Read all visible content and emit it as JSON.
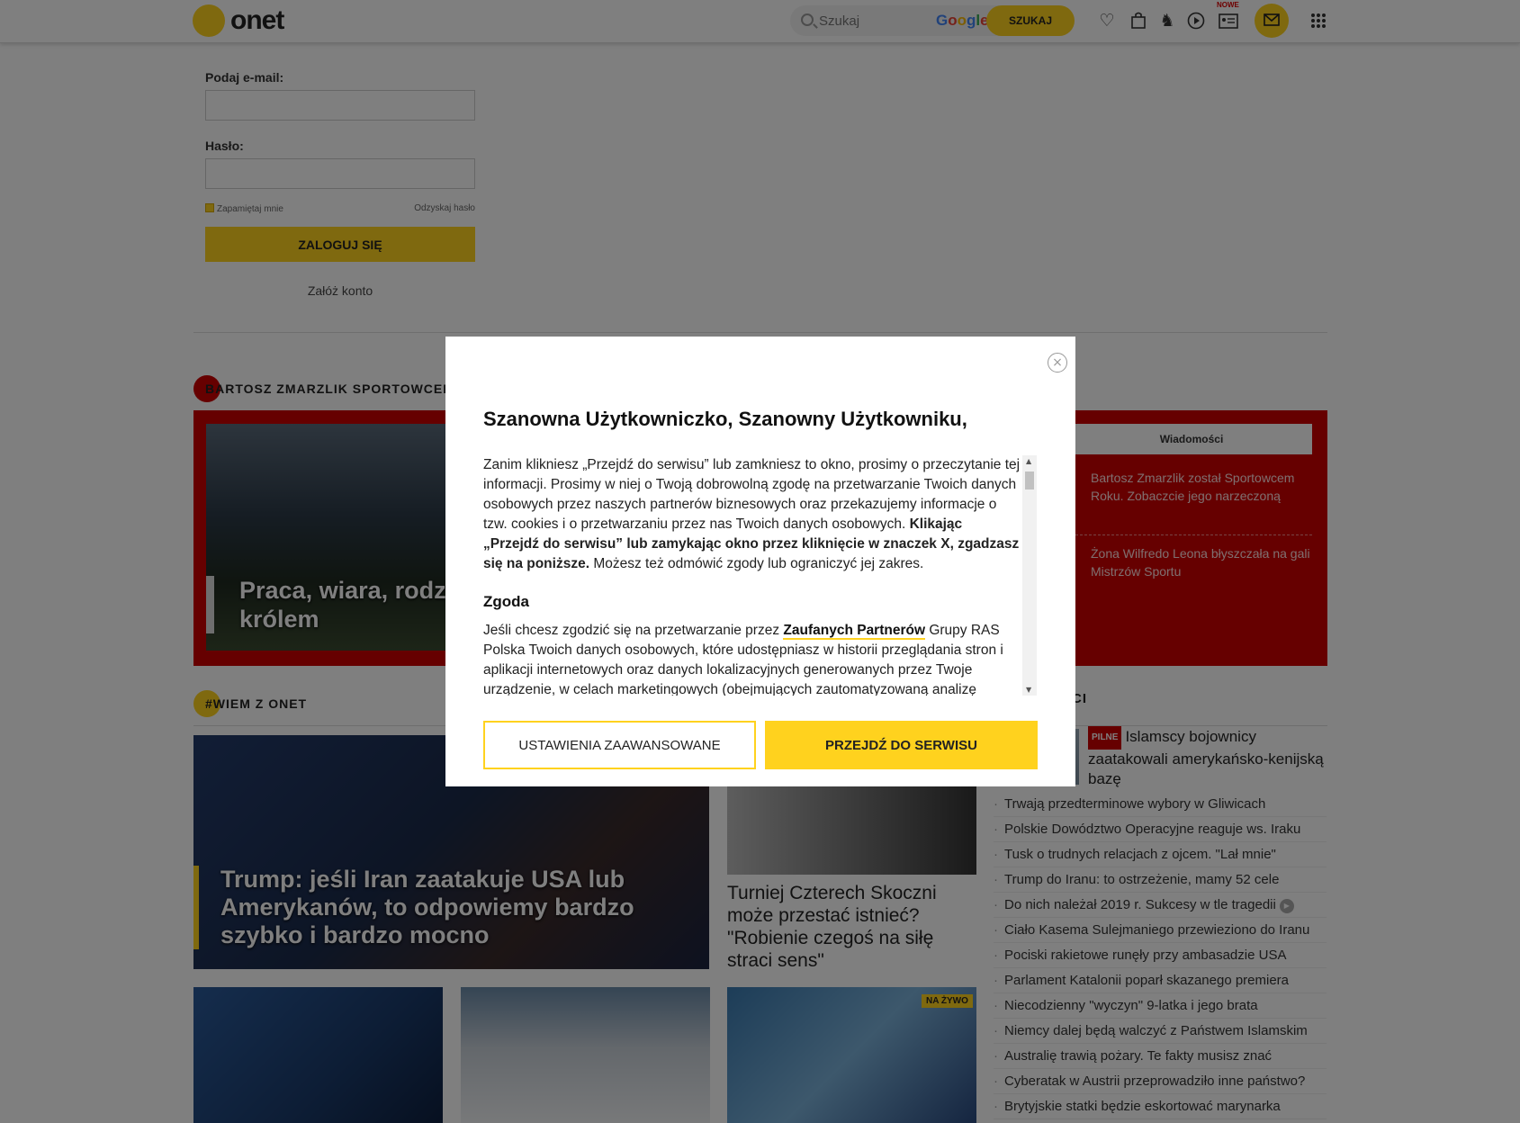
{
  "header": {
    "logo_text": "onet",
    "search_placeholder": "Szukaj",
    "google_letters": [
      "G",
      "o",
      "o",
      "g",
      "l",
      "e"
    ],
    "search_button": "SZUKAJ",
    "new_badge": "NOWE",
    "icons": [
      "heart-icon",
      "shopping-bag-icon",
      "horoscope-icon",
      "play-icon",
      "news-card-icon",
      "mail-icon",
      "apps-grid-icon"
    ]
  },
  "login": {
    "email_label": "Podaj e-mail:",
    "password_label": "Hasło:",
    "remember_label": "Zapamiętaj mnie",
    "recover_label": "Odzyskaj hasło",
    "submit_label": "ZALOGUJ SIĘ",
    "register_label": "Załóż konto"
  },
  "sport": {
    "section_title": "BARTOSZ ZMARZLIK SPORTOWCEM R",
    "headline": "Praca, wiara, rodzin który został królem",
    "tab_label": "Wiadomości",
    "side_news": [
      "Bartosz Zmarzlik został Sportowcem Roku. Zobaczcie jego narzeczoną",
      "Żona Wilfredo Leona błyszczała na gali Mistrzów Sportu"
    ]
  },
  "wiem": {
    "section_title": "#WIEM Z ONET",
    "main_headline": "Trump: jeśli Iran zaatakuje USA lub Amerykanów, to odpowiemy bardzo szybko i bardzo mocno",
    "skocznia_headline": "Turniej Czterech Skoczni może przestać istnieć? \"Robienie czegoś na siłę straci sens\"",
    "live_badge": "NA ŻYWO"
  },
  "news": {
    "section_title": "ŚCI",
    "pilne_badge": "PILNE",
    "pilne_headline": "Islamscy bojownicy zaatakowali amerykańsko-kenijską bazę",
    "items": [
      "Trwają przedterminowe wybory w Gliwicach",
      "Polskie Dowództwo Operacyjne reaguje ws. Iraku",
      "Tusk o trudnych relacjach z ojcem. \"Lał mnie\"",
      "Trump do Iranu: to ostrzeżenie, mamy 52 cele",
      "Do nich należał 2019 r. Sukcesy w tle tragedii",
      "Ciało Kasema Sulejmaniego przewieziono do Iranu",
      "Pociski rakietowe runęły przy ambasadzie USA",
      "Parlament Katalonii poparł skazanego premiera",
      "Niecodzienny \"wyczyn\" 9-latka i jego brata",
      "Niemcy dalej będą walczyć z Państwem Islamskim",
      "Australię trawią pożary. Te fakty musisz znać",
      "Cyberatak w Austrii przeprowadziło inne państwo?",
      "Brytyjskie statki będzie eskortować marynarka"
    ]
  },
  "modal": {
    "title": "Szanowna Użytkowniczko, Szanowny Użytkowniku,",
    "close_symbol": "×",
    "intro_plain": "Zanim klikniesz „Przejdź do serwisu” lub zamkniesz to okno, prosimy o przeczytanie tej informacji. Prosimy w niej o Twoją dobrowolną zgodę na przetwarzanie Twoich danych osobowych przez naszych partnerów biznesowych oraz przekazujemy informacje o tzw. cookies i o przetwarzaniu przez nas Twoich danych osobowych. ",
    "intro_bold": "Klikając „Przejdź do serwisu” lub zamykając okno przez kliknięcie w znaczek X, zgadzasz się na poniższe.",
    "intro_tail": " Możesz też odmówić zgody lub ograniczyć jej zakres.",
    "consent_heading": "Zgoda",
    "consent_pre": "Jeśli chcesz zgodzić się na przetwarzanie przez ",
    "consent_link": "Zaufanych Partnerów",
    "consent_post": " Grupy RAS Polska Twoich danych osobowych, które udostępniasz w historii przeglądania stron i aplikacji internetowych oraz danych lokalizacyjnych generowanych przez Twoje urządzenie, w celach marketingowych (obejmujących zautomatyzowaną analizę",
    "advanced_button": "USTAWIENIA ZAAWANSOWANE",
    "proceed_button": "PRZEJDŹ DO SERWISU"
  },
  "colors": {
    "brand_yellow": "#ffd21e",
    "sport_red": "#cc0000",
    "overlay": "rgba(0,0,0,0.5)"
  }
}
